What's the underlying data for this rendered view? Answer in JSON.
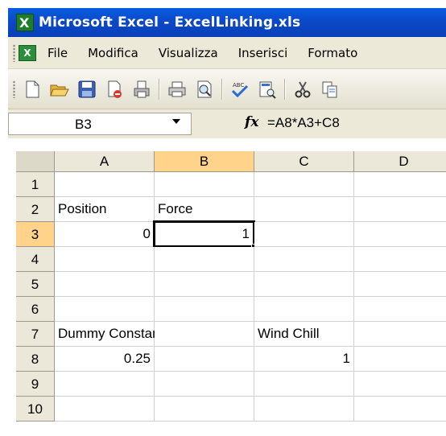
{
  "window": {
    "title": "Microsoft Excel - ExcelLinking.xls"
  },
  "menu": [
    "File",
    "Modifica",
    "Visualizza",
    "Inserisci",
    "Formato"
  ],
  "toolbar_icons": [
    "new-document-icon",
    "open-folder-icon",
    "save-icon",
    "permission-icon",
    "print-area-icon",
    "print-icon",
    "print-preview-icon",
    "spelling-icon",
    "research-icon",
    "cut-icon",
    "copy-icon"
  ],
  "formula_bar": {
    "name_box": "B3",
    "fx": "fx",
    "formula": "=A8*A3+C8"
  },
  "columns": [
    "A",
    "B",
    "C",
    "D"
  ],
  "rows": [
    "1",
    "2",
    "3",
    "4",
    "5",
    "6",
    "7",
    "8",
    "9",
    "10"
  ],
  "cells": {
    "A2": "Position",
    "B2": "Force",
    "A3": "0",
    "B3": "1",
    "A7": "Dummy Constant",
    "C7": "Wind Chill",
    "A8": "0.25",
    "C8": "1"
  },
  "selected_cell": "B3"
}
